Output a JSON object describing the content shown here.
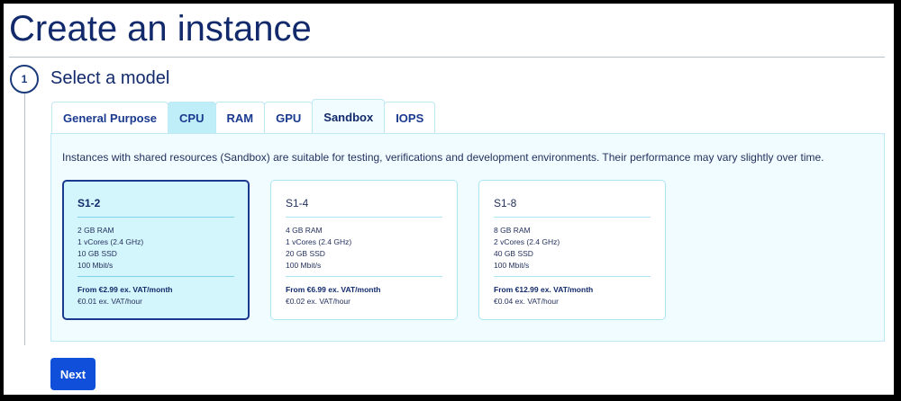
{
  "page": {
    "title": "Create an instance"
  },
  "step": {
    "number": "1",
    "title": "Select a model"
  },
  "tabs": [
    {
      "label": "General Purpose"
    },
    {
      "label": "CPU"
    },
    {
      "label": "RAM"
    },
    {
      "label": "GPU"
    },
    {
      "label": "Sandbox"
    },
    {
      "label": "IOPS"
    }
  ],
  "active_tab": "Sandbox",
  "panel": {
    "description": "Instances with shared resources (Sandbox) are suitable for testing, verifications and development environments. Their performance may vary slightly over time."
  },
  "models": [
    {
      "name": "S1-2",
      "specs": [
        "2 GB RAM",
        "1 vCores (2.4 GHz)",
        "10 GB SSD",
        "100 Mbit/s"
      ],
      "price_month": "From €2.99 ex. VAT/month",
      "price_hour": "€0.01 ex. VAT/hour",
      "selected": true
    },
    {
      "name": "S1-4",
      "specs": [
        "4 GB RAM",
        "1 vCores (2.4 GHz)",
        "20 GB SSD",
        "100 Mbit/s"
      ],
      "price_month": "From €6.99 ex. VAT/month",
      "price_hour": "€0.02 ex. VAT/hour",
      "selected": false
    },
    {
      "name": "S1-8",
      "specs": [
        "8 GB RAM",
        "2 vCores (2.4 GHz)",
        "40 GB SSD",
        "100 Mbit/s"
      ],
      "price_month": "From €12.99 ex. VAT/month",
      "price_hour": "€0.04 ex. VAT/hour",
      "selected": false
    }
  ],
  "actions": {
    "next_label": "Next"
  },
  "colors": {
    "brand_navy": "#122a6b",
    "primary_button": "#0f4fd9",
    "panel_background": "#f0fcff",
    "selected_card": "#d3f5fc",
    "accent_border": "#a9e6f2"
  }
}
